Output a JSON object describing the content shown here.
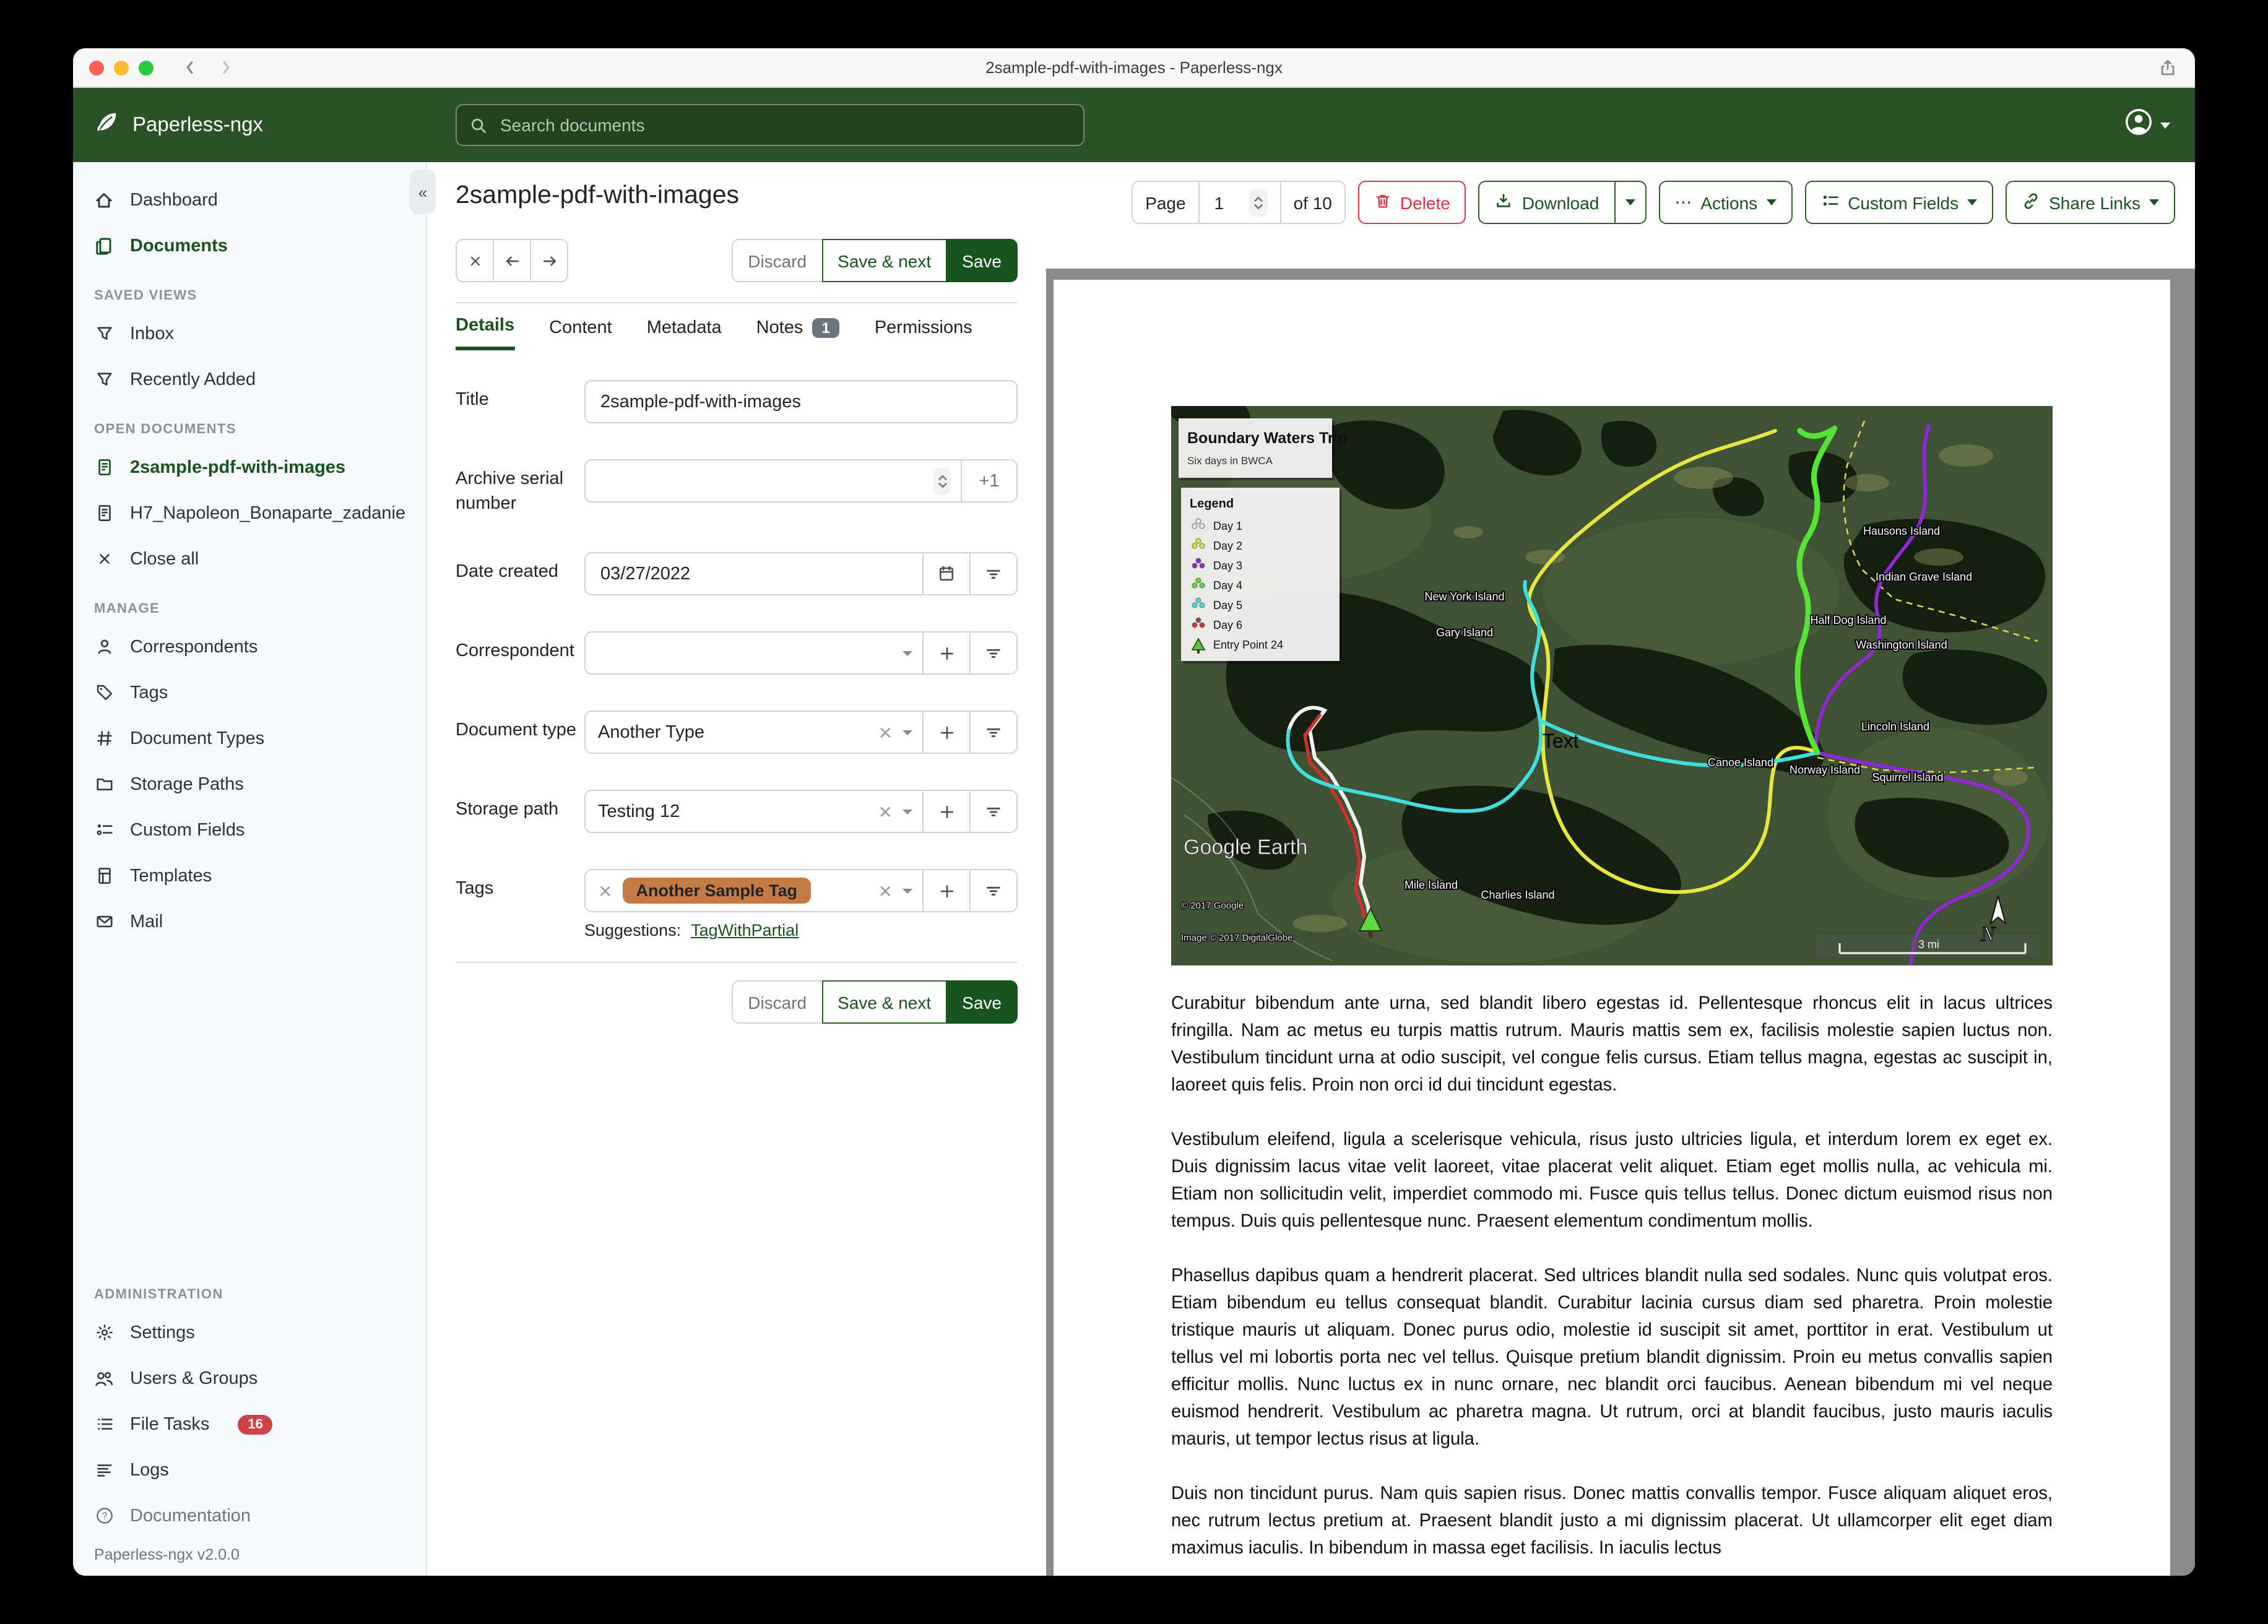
{
  "window": {
    "title": "2sample-pdf-with-images - Paperless-ngx"
  },
  "header": {
    "brand": "Paperless-ngx",
    "search_placeholder": "Search documents"
  },
  "sidebar": {
    "top": [
      {
        "label": "Dashboard",
        "icon": "home-icon"
      },
      {
        "label": "Documents",
        "icon": "documents-icon"
      }
    ],
    "sections": [
      {
        "title": "SAVED VIEWS",
        "items": [
          {
            "label": "Inbox"
          },
          {
            "label": "Recently Added"
          }
        ]
      },
      {
        "title": "OPEN DOCUMENTS",
        "items": [
          {
            "label": "2sample-pdf-with-images"
          },
          {
            "label": "H7_Napoleon_Bonaparte_zadanie"
          },
          {
            "label": "Close all"
          }
        ]
      },
      {
        "title": "MANAGE",
        "items": [
          {
            "label": "Correspondents"
          },
          {
            "label": "Tags"
          },
          {
            "label": "Document Types"
          },
          {
            "label": "Storage Paths"
          },
          {
            "label": "Custom Fields"
          },
          {
            "label": "Templates"
          },
          {
            "label": "Mail"
          }
        ]
      },
      {
        "title": "ADMINISTRATION",
        "items": [
          {
            "label": "Settings"
          },
          {
            "label": "Users & Groups"
          },
          {
            "label": "File Tasks",
            "badge": "16"
          },
          {
            "label": "Logs"
          }
        ]
      }
    ],
    "footer": {
      "documentation": "Documentation",
      "version": "Paperless-ngx v2.0.0"
    }
  },
  "toolbar": {
    "page_label": "Page",
    "page_value": "1",
    "page_of": "of 10",
    "delete": "Delete",
    "download": "Download",
    "actions": "Actions",
    "custom_fields": "Custom Fields",
    "share_links": "Share Links"
  },
  "doc": {
    "title": "2sample-pdf-with-images"
  },
  "edit": {
    "discard": "Discard",
    "save_next": "Save & next",
    "save": "Save",
    "tabs": [
      {
        "label": "Details"
      },
      {
        "label": "Content"
      },
      {
        "label": "Metadata"
      },
      {
        "label": "Notes",
        "badge": "1"
      },
      {
        "label": "Permissions"
      }
    ],
    "fields": {
      "title_label": "Title",
      "title_value": "2sample-pdf-with-images",
      "asn_label": "Archive serial number",
      "asn_plus": "+1",
      "date_label": "Date created",
      "date_value": "03/27/2022",
      "correspondent_label": "Correspondent",
      "doctype_label": "Document type",
      "doctype_value": "Another Type",
      "storage_label": "Storage path",
      "storage_value": "Testing 12",
      "tags_label": "Tags",
      "tag_value": "Another Sample Tag",
      "tag_color": "#c67b44",
      "suggestions_label": "Suggestions:",
      "suggestion_link": "TagWithPartial"
    }
  },
  "preview": {
    "map": {
      "title": "Boundary Waters Trip",
      "subtitle": "Six days in BWCA",
      "legend_title": "Legend",
      "legend_items": [
        {
          "label": "Day 1",
          "color": "#e4e8e4"
        },
        {
          "label": "Day 2",
          "color": "#e6e63c"
        },
        {
          "label": "Day 3",
          "color": "#9426d9"
        },
        {
          "label": "Day 4",
          "color": "#55e335"
        },
        {
          "label": "Day 5",
          "color": "#41dede"
        },
        {
          "label": "Day 6",
          "color": "#d23030"
        },
        {
          "label": "Entry Point 24",
          "color": "#58c43a"
        }
      ],
      "labels": [
        "Hausons Island",
        "New York Island",
        "Gary Island",
        "Indian Grave Island",
        "Half Dog Island",
        "Washington Island",
        "Lincoln Island",
        "Canoe Island",
        "Norway Island",
        "Squirrel Island",
        "Mile Island",
        "Charlies Island"
      ],
      "text_annotation": "Text",
      "credit": "Google Earth",
      "copyright1": "© 2017 Google",
      "copyright2": "Image © 2017 DigitalGlobe",
      "scale_label": "3 mi",
      "north_label": "N"
    },
    "paragraphs": [
      "Curabitur bibendum ante urna, sed blandit libero egestas id. Pellentesque rhoncus elit in lacus ultrices fringilla. Nam ac metus eu turpis mattis rutrum. Mauris mattis sem ex, facilisis molestie sapien luctus non. Vestibulum tincidunt urna at odio suscipit, vel congue felis cursus. Etiam tellus magna, egestas ac suscipit in, laoreet quis felis. Proin non orci id dui tincidunt egestas.",
      "Vestibulum eleifend, ligula a scelerisque vehicula, risus justo ultricies ligula, et interdum lorem ex eget ex. Duis dignissim lacus vitae velit laoreet, vitae placerat velit aliquet. Etiam eget mollis nulla, ac vehicula mi. Etiam non sollicitudin velit, imperdiet commodo mi. Fusce quis tellus tellus. Donec dictum euismod risus non tempus. Duis quis pellentesque nunc. Praesent elementum condimentum mollis.",
      "Phasellus dapibus quam a hendrerit placerat. Sed ultrices blandit nulla sed sodales. Nunc quis volutpat eros. Etiam bibendum eu tellus consequat blandit. Curabitur lacinia cursus diam sed pharetra. Proin molestie tristique mauris ut aliquam. Donec purus odio, molestie id suscipit sit amet, porttitor in erat. Vestibulum ut tellus vel mi lobortis porta nec vel tellus. Quisque pretium blandit dignissim. Proin eu metus convallis sapien efficitur mollis. Nunc luctus ex in nunc ornare, nec blandit orci faucibus. Aenean bibendum mi vel neque euismod hendrerit. Vestibulum ac pharetra magna. Ut rutrum, orci at blandit faucibus, justo mauris iaculis mauris, ut tempor lectus risus at ligula.",
      "Duis non tincidunt purus. Nam quis sapien risus. Donec mattis convallis tempor. Fusce aliquam aliquet eros, nec rutrum lectus pretium at. Praesent blandit justo a mi dignissim placerat. Ut ullamcorper elit eget diam maximus iaculis. In bibendum in massa eget facilisis. In iaculis lectus"
    ]
  },
  "colors": {
    "header_green": "#2b5226",
    "accent_green": "#17541f",
    "danger_red": "#dc3545",
    "badge_red": "#ce4246",
    "tag_brown": "#c67b44",
    "preview_gray": "#8a8a8a"
  }
}
